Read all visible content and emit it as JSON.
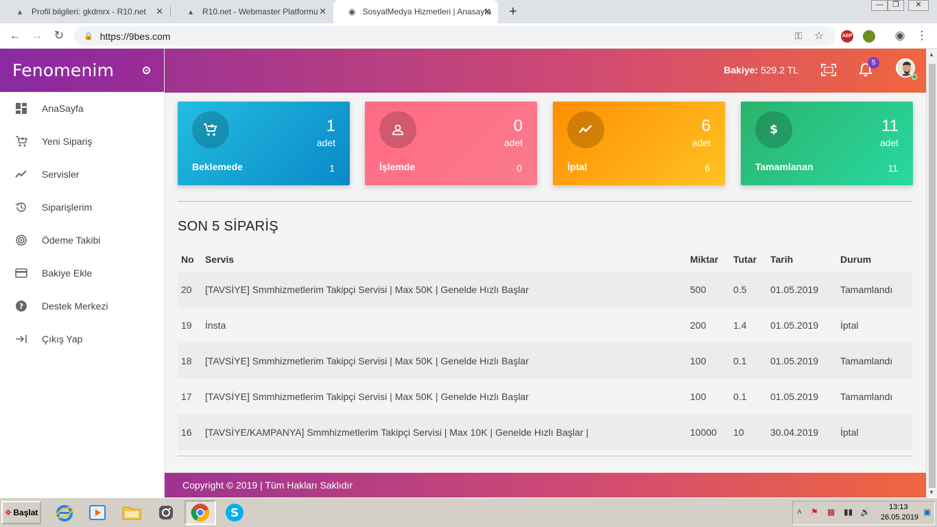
{
  "browser": {
    "tabs": [
      {
        "title": "Profil bilgileri: gkdmrx - R10.net"
      },
      {
        "title": "R10.net - Webmaster Platformu"
      },
      {
        "title": "SosyalMedya Hizmetleri | Anasayfa"
      }
    ],
    "url": "https://9bes.com",
    "extensions": [
      "ABP"
    ]
  },
  "sidebar": {
    "brand": "Fenomenim",
    "items": [
      {
        "label": "AnaSayfa",
        "icon": "dashboard-icon"
      },
      {
        "label": "Yeni Sipariş",
        "icon": "cart-icon"
      },
      {
        "label": "Servisler",
        "icon": "trending-icon"
      },
      {
        "label": "Siparişlerim",
        "icon": "history-icon"
      },
      {
        "label": "Ödeme Takibi",
        "icon": "track-icon"
      },
      {
        "label": "Bakiye Ekle",
        "icon": "credit-card-icon"
      },
      {
        "label": "Destek Merkezi",
        "icon": "help-icon"
      },
      {
        "label": "Çıkış Yap",
        "icon": "logout-icon"
      }
    ]
  },
  "header": {
    "balance_label": "Bakiye:",
    "balance_value": "529.2 TL",
    "notification_count": "5"
  },
  "cards": {
    "pending": {
      "count": "1",
      "unit": "adet",
      "label": "Beklemede",
      "value": "1"
    },
    "processing": {
      "count": "0",
      "unit": "adet",
      "label": "İşlemde",
      "value": "0"
    },
    "cancelled": {
      "count": "6",
      "unit": "adet",
      "label": "İptal",
      "value": "6"
    },
    "completed": {
      "count": "11",
      "unit": "adet",
      "label": "Tamamlanan",
      "value": "11"
    }
  },
  "orders": {
    "title": "SON 5 SİPARİŞ",
    "columns": {
      "no": "No",
      "service": "Servis",
      "qty": "Miktar",
      "amount": "Tutar",
      "date": "Tarih",
      "status": "Durum"
    },
    "rows": [
      {
        "no": "20",
        "service": "[TAVSİYE] Smmhizmetlerim Takipçi Servisi | Max 50K | Genelde Hızlı Başlar",
        "qty": "500",
        "amount": "0.5",
        "date": "01.05.2019",
        "status": "Tamamlandı"
      },
      {
        "no": "19",
        "service": "İnsta",
        "qty": "200",
        "amount": "1.4",
        "date": "01.05.2019",
        "status": "İptal"
      },
      {
        "no": "18",
        "service": "[TAVSİYE] Smmhizmetlerim Takipçi Servisi | Max 50K | Genelde Hızlı Başlar",
        "qty": "100",
        "amount": "0.1",
        "date": "01.05.2019",
        "status": "Tamamlandı"
      },
      {
        "no": "17",
        "service": "[TAVSİYE] Smmhizmetlerim Takipçi Servisi | Max 50K | Genelde Hızlı Başlar",
        "qty": "100",
        "amount": "0.1",
        "date": "01.05.2019",
        "status": "Tamamlandı"
      },
      {
        "no": "16",
        "service": "[TAVSİYE/KAMPANYA] Smmhizmetlerim Takipçi Servisi | Max 10K | Genelde Hızlı Başlar |",
        "qty": "10000",
        "amount": "10",
        "date": "30.04.2019",
        "status": "İptal"
      }
    ]
  },
  "footer": {
    "text": "Copyright © 2019 | Tüm Hakları Saklıdır"
  },
  "taskbar": {
    "start_label": "Başlat",
    "time": "13:13",
    "date": "26.05.2019"
  }
}
